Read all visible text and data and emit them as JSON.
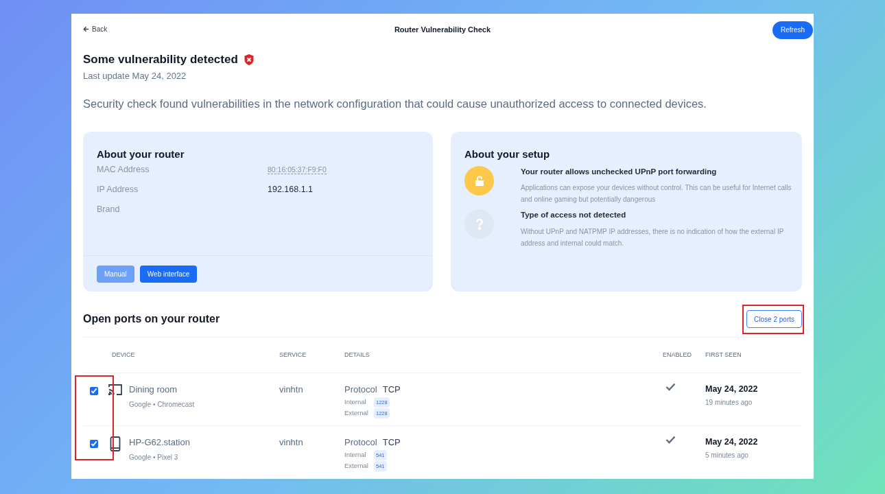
{
  "header": {
    "back": "Back",
    "title": "Router Vulnerability Check",
    "refresh": "Refresh"
  },
  "status": {
    "title": "Some vulnerability detected",
    "vulnerable": true,
    "last_update": "Last update May 24, 2022",
    "description": "Security check found vulnerabilities in the network configuration that could cause unauthorized access to connected devices."
  },
  "router": {
    "title": "About your router",
    "fields": [
      {
        "label": "MAC Address",
        "value": "80:16:05:37:F9:F0",
        "kind": "masked"
      },
      {
        "label": "IP Address",
        "value": "192.168.1.1",
        "kind": "plain"
      },
      {
        "label": "Brand"
      }
    ],
    "buttons": [
      {
        "label": "Manual",
        "disabled": true
      },
      {
        "label": "Web interface",
        "disabled": false
      }
    ]
  },
  "setup": {
    "title": "About your setup",
    "items": [
      {
        "kind": "warning",
        "title": "Your router allows unchecked UPnP port forwarding",
        "text": "Applications can expose your devices without control. This can be useful for Internet calls and online gaming but potentially dangerous"
      },
      {
        "kind": "unknown",
        "title": "Type of access not detected",
        "text": "Without UPnP and NATPMP IP addresses, there is no indication of how the external IP address and internal could match."
      }
    ]
  },
  "ports": {
    "title": "Open ports on your router",
    "close_button": {
      "label": "Close 2 ports",
      "highlighted": true
    },
    "checkboxes_highlighted": true,
    "columns": [
      "DEVICE",
      "SERVICE",
      "DETAILS",
      "ENABLED",
      "FIRST SEEN"
    ],
    "rows": [
      {
        "checked": true,
        "kind": "cast",
        "device": "Dining room",
        "model": "Google • Chromecast",
        "service": "vinhtn",
        "protocol_label": "Protocol",
        "protocol": "TCP",
        "internal_label": "Internal",
        "internal": "1228",
        "external_label": "External",
        "external": "1228",
        "enabled": true,
        "date": "May 24, 2022",
        "ago": "19 minutes ago"
      },
      {
        "checked": true,
        "kind": "phone",
        "device": "HP-G62.station",
        "model": "Google • Pixel 3",
        "service": "vinhtn",
        "protocol_label": "Protocol",
        "protocol": "TCP",
        "internal_label": "Internal",
        "internal": "541",
        "external_label": "External",
        "external": "541",
        "enabled": true,
        "date": "May 24, 2022",
        "ago": "5 minutes ago"
      }
    ]
  }
}
